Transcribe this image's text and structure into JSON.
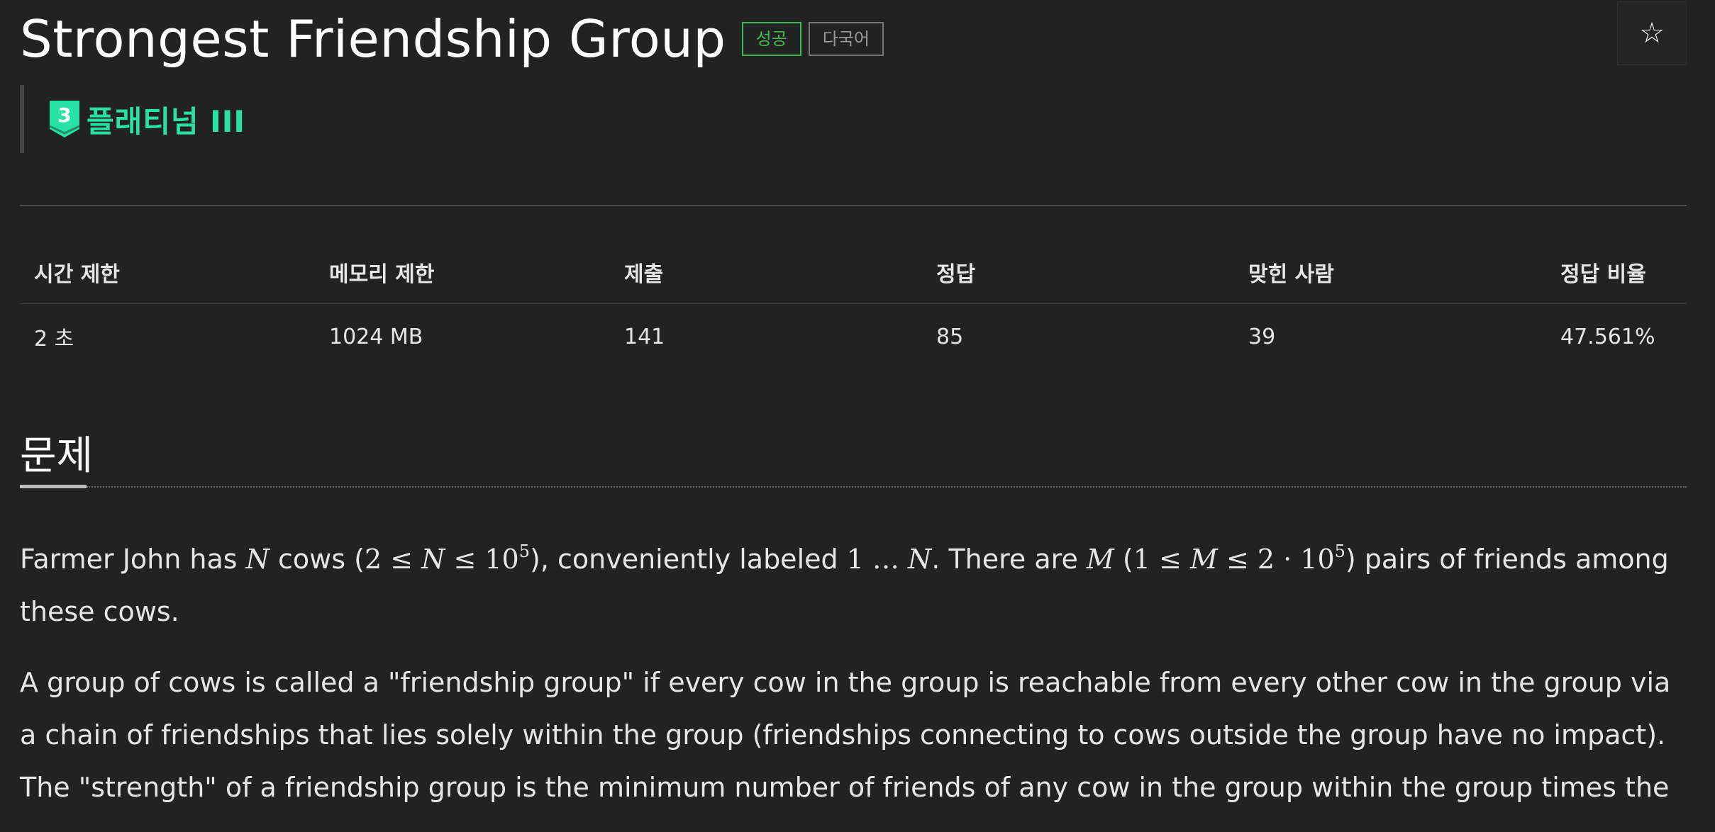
{
  "problem": {
    "title": "Strongest Friendship Group",
    "badges": {
      "success": "성공",
      "multilang": "다국어"
    },
    "star_icon": "☆",
    "tier": {
      "number": "3",
      "label": "플래티넘 III",
      "color": "#27e2a4"
    }
  },
  "info_table": {
    "headers": [
      "시간 제한",
      "메모리 제한",
      "제출",
      "정답",
      "맞힌 사람",
      "정답 비율"
    ],
    "values": [
      "2 초",
      "1024 MB",
      "141",
      "85",
      "39",
      "47.561%"
    ]
  },
  "section": {
    "title": "문제"
  },
  "description": {
    "p1": {
      "t1": "Farmer John has ",
      "m1": "N",
      "t2": " cows (",
      "m2": "2 ≤ ",
      "m3": "N",
      "m4": " ≤ 10",
      "sup1": "5",
      "t3": "), conveniently labeled ",
      "m5": "1 … ",
      "m6": "N",
      "t4": ". There are ",
      "m7": "M",
      "t5": " (",
      "m8": "1 ≤ ",
      "m9": "M",
      "m10": " ≤ 2 · 10",
      "sup2": "5",
      "t6": ") pairs of friends among these cows."
    },
    "p2": "A group of cows is called a \"friendship group\" if every cow in the group is reachable from every other cow in the group via a chain of friendships that lies solely within the group (friendships connecting to cows outside the group have no impact). The \"strength\" of a friendship group is the minimum number of friends of any cow in the group within the group times the"
  },
  "colors": {
    "background": "#222222",
    "text": "#e6e6e6",
    "success": "#3fb950",
    "tier": "#27e2a4"
  }
}
